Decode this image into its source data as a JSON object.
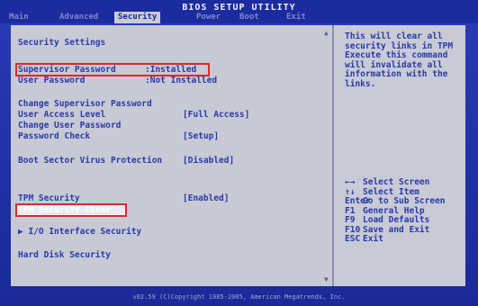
{
  "title": "BIOS SETUP UTILITY",
  "menu": [
    "Main",
    "Advanced",
    "Security",
    "Power",
    "Boot",
    "Exit"
  ],
  "active_menu_index": 2,
  "section_title": "Security Settings",
  "rows": {
    "supervisor_password": {
      "label": "Supervisor Password",
      "value": ":Installed"
    },
    "user_password": {
      "label": "User Password",
      "value": ":Not Installed"
    },
    "change_supervisor": {
      "label": "Change Supervisor Password"
    },
    "user_access": {
      "label": "User Access Level",
      "value": "[Full Access]"
    },
    "change_user": {
      "label": "Change User Password"
    },
    "password_check": {
      "label": "Password Check",
      "value": "[Setup]"
    },
    "boot_virus": {
      "label": "Boot Sector Virus Protection",
      "value": "[Disabled]"
    },
    "tpm_security": {
      "label": "TPM Security",
      "value": "[Enabled]"
    },
    "tpm_clear": {
      "label": "TPM Security Clear"
    },
    "io_security": {
      "label": "▶ I/O Interface Security"
    },
    "hdd_security": {
      "label": "Hard Disk Security"
    }
  },
  "help_text": "This will clear all security links in TPM Execute this command will invalidate all information with the links.",
  "keys": [
    {
      "key": "←→",
      "desc": "Select Screen"
    },
    {
      "key": "↑↓",
      "desc": "Select Item"
    },
    {
      "key": "Enter",
      "desc": "Go to Sub Screen"
    },
    {
      "key": "F1",
      "desc": "General Help"
    },
    {
      "key": "F9",
      "desc": "Load Defaults"
    },
    {
      "key": "F10",
      "desc": "Save and Exit"
    },
    {
      "key": "ESC",
      "desc": "Exit"
    }
  ],
  "footer": "v02.59 (C)Copyright 1985-2005, American Megatrends, Inc."
}
